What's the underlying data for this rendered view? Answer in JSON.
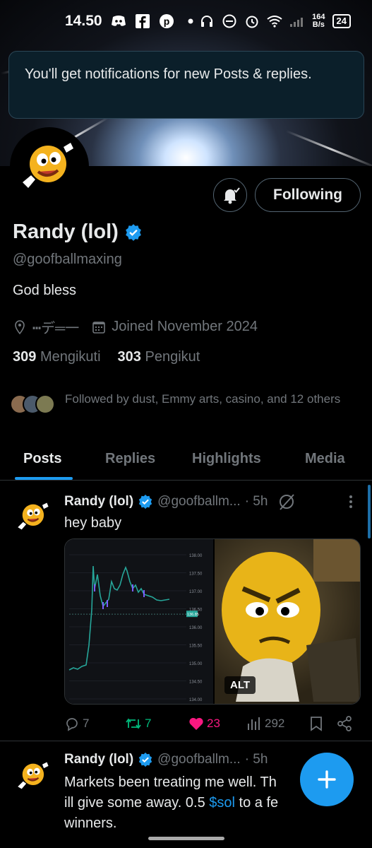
{
  "status_bar": {
    "time": "14.50",
    "net_speed_value": "164",
    "net_speed_unit": "B/s",
    "battery": "24"
  },
  "toast": {
    "message": "You'll get notifications for new Posts & replies."
  },
  "profile": {
    "name": "Randy (lol)",
    "handle": "@goofballmaxing",
    "bio": "God bless",
    "location": "┅デ═一",
    "joined": "Joined November 2024",
    "following_count": "309",
    "following_label": "Mengikuti",
    "followers_count": "303",
    "followers_label": "Pengikut",
    "followed_by": "Followed by dust, Emmy arts, casino, and 12 others",
    "follow_button": "Following"
  },
  "tabs": [
    {
      "label": "Posts",
      "active": true
    },
    {
      "label": "Replies",
      "active": false
    },
    {
      "label": "Highlights",
      "active": false
    },
    {
      "label": "Media",
      "active": false
    }
  ],
  "posts": [
    {
      "name": "Randy (lol)",
      "handle": "@goofballm...",
      "time": "· 5h",
      "text": "hey baby",
      "alt": "ALT",
      "replies": "7",
      "reposts": "7",
      "likes": "23",
      "views": "292"
    },
    {
      "name": "Randy (lol)",
      "handle": "@goofballm...",
      "time": "· 5h",
      "text_a": "Markets been treating me well. Th",
      "text_b": "ill give some away. 0.5 ",
      "cashtag": "$sol",
      "text_c": " to a fe",
      "text_d": "winners."
    }
  ],
  "chart_axis": {
    "labels": [
      "138.00",
      "137.50",
      "137.00",
      "136.50",
      "136.00",
      "135.50",
      "135.00",
      "134.50",
      "134.00"
    ],
    "current": "136.85"
  },
  "colors": {
    "accent": "#1d9bf0",
    "verified": "#1d9bf0",
    "repost": "#00ba7c",
    "like": "#f91880",
    "muted": "#71767b"
  }
}
